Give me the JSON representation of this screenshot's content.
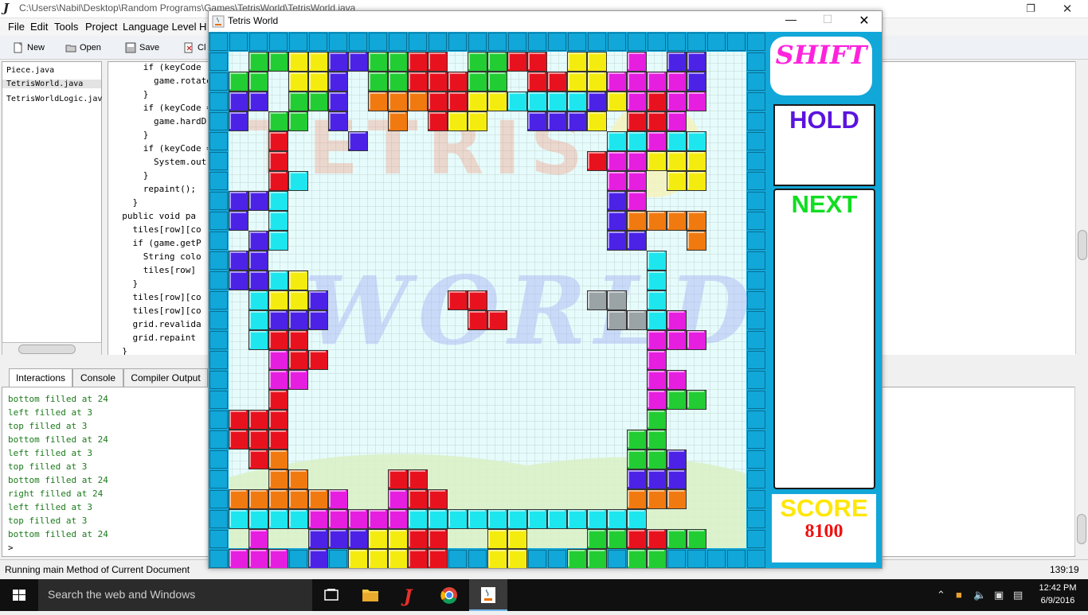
{
  "ide": {
    "title": "C:\\Users\\Nabil\\Desktop\\Random Programs\\Games\\TetrisWorld\\TetrisWorld.java",
    "menu": [
      "File",
      "Edit",
      "Tools",
      "Project",
      "Language Level",
      "H"
    ],
    "toolbar": {
      "new": "New",
      "open": "Open",
      "save": "Save",
      "close": "Cl"
    },
    "files": [
      "Piece.java",
      "TetrisWorld.java",
      "TetrisWorldLogic.jav"
    ],
    "code_lines": [
      "      if (keyCode",
      "        game.rotate",
      "      }",
      "      if (keyCode =",
      "        game.hardD",
      "      }",
      "      if (keyCode =",
      "        System.out",
      "      }",
      "      repaint();",
      "    }",
      "  public void pa",
      "    tiles[row][co",
      "    if (game.getP",
      "      String colo",
      "      tiles[row]",
      "    }",
      "    tiles[row][co",
      "    tiles[row][co",
      "    grid.revalida",
      "    grid.repaint",
      "  }"
    ],
    "tabs": [
      "Interactions",
      "Console",
      "Compiler Output"
    ],
    "console_lines": [
      "bottom filled at 24",
      "left filled at 3",
      "top filled at 3",
      "bottom filled at 24",
      "left filled at 3",
      "top filled at 3",
      "bottom filled at 24",
      "right filled at 24",
      "left filled at 3",
      "top filled at 3",
      "bottom filled at 24"
    ],
    "prompt": ">",
    "status": "Running main Method of Current Document",
    "cursor_pos": "139:19"
  },
  "taskbar": {
    "search_placeholder": "Search the web and Windows",
    "time": "12:42 PM",
    "date": "6/9/2016"
  },
  "tetris": {
    "title": "Tetris World",
    "shift_label": "SHIFT",
    "hold_label": "HOLD",
    "next_label": "NEXT",
    "score_label": "SCORE",
    "score": "8100",
    "watermark_top": "TETRIS",
    "watermark_bottom": "WORLD",
    "colors": {
      "border": "#11a7d9",
      "R": "#e8121e",
      "G": "#22cc33",
      "Y": "#f5ec0f",
      "B": "#4b22e6",
      "M": "#e61ee0",
      "C": "#1ee6ee",
      "O": "#f07a10",
      "S": "#9aa3a6"
    },
    "board_rows": [
      ".GGYYBBGGRR.GGRR.YY.M.BB",
      "GG.YYB.GGRRRGG.RRYYMMMMB",
      "BB.GGB.OOORRYYCCCCBYMRMM",
      "B.GG.B..O.RYY..BBBY.RRM.",
      "..R...B............CCMCC",
      "..R...............RMMYYY",
      "..RC...............MM.YY",
      "BBC................BM...",
      "B.C................BOOOO",
      ".BC................BB..O",
      "BB...................C..",
      "BBCY.................C..",
      ".CYYB......RR.....SS.C..",
      ".CBBB.......RR.....SSCM.",
      ".CRR.................MMM",
      "..MRR................M..",
      "..MM.................MM.",
      "..R..................MGG",
      "RRR..................G..",
      "RRR.................GG..",
      ".RO.................GGB.",
      "..OO....RR..........BBB.",
      "OOOOOM..MRR.........OOO.",
      "CCCCMMMMMCCCCCCCCCCCC...",
      ".M..BBBYYRR..YY...GGRRGG",
      "MMM.B.YYYRR..YY..GG.GG.."
    ]
  }
}
